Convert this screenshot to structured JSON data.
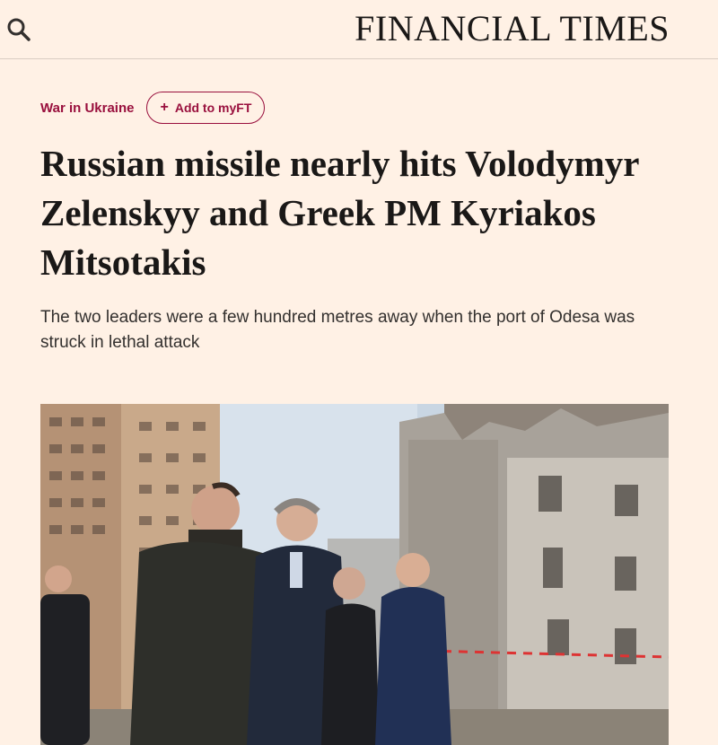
{
  "header": {
    "masthead": "FINANCIAL TIMES",
    "search_icon": "search-icon"
  },
  "article": {
    "topic": "War in Ukraine",
    "add_to_myft": "Add to myFT",
    "headline": "Russian missile nearly hits Volodymyr Zelenskyy and Greek PM Kyriakos Mitsotakis",
    "standfirst": "The two leaders were a few hundred metres away when the port of Odesa was struck in lethal attack"
  },
  "colors": {
    "background": "#fff1e5",
    "accent": "#990f3d",
    "text": "#33302e"
  }
}
